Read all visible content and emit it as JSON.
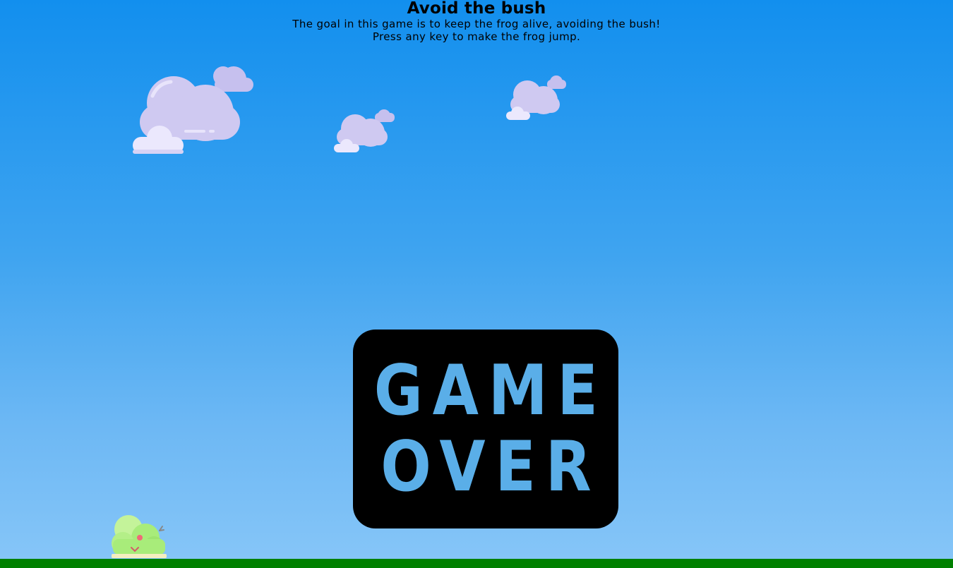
{
  "game": {
    "title": "Avoid the bush",
    "description_line1": "The goal in this game is to keep the frog alive, avoiding the bush!",
    "description_line2": "Press any key to make the frog jump."
  },
  "game_over": {
    "word1": "GAME",
    "word2": "OVER"
  },
  "sprites": {
    "clouds": [
      "cloud-icon",
      "cloud-icon",
      "cloud-icon"
    ],
    "obstacle": "bush-icon",
    "ground": "ground-strip"
  },
  "colors": {
    "sky_top": "#128fee",
    "sky_bottom": "#87c6f8",
    "ground": "#008000",
    "game_over_text": "#5aaee8",
    "game_over_panel": "#000000",
    "cloud": "#cfc9f0",
    "bush": "#a8ec7a"
  }
}
